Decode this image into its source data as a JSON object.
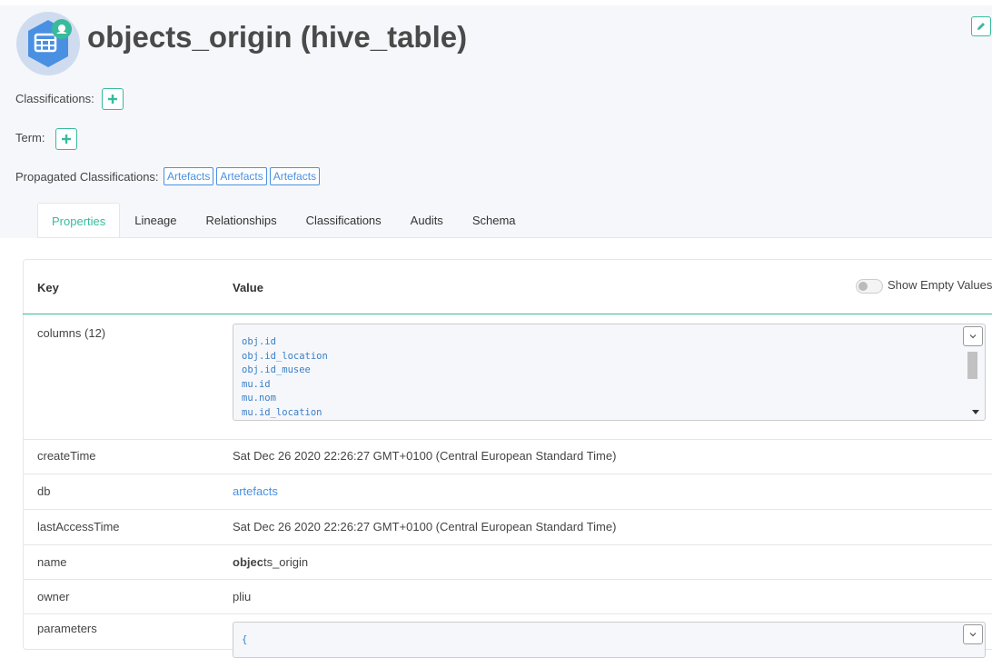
{
  "entity": {
    "title": "objects_origin (hive_table)"
  },
  "fields": {
    "classifications_label": "Classifications:",
    "term_label": "Term:",
    "propagated_label": "Propagated Classifications:",
    "propagated_tags": [
      "Artefacts",
      "Artefacts",
      "Artefacts"
    ]
  },
  "tabs": [
    {
      "label": "Properties",
      "active": true
    },
    {
      "label": "Lineage"
    },
    {
      "label": "Relationships"
    },
    {
      "label": "Classifications"
    },
    {
      "label": "Audits"
    },
    {
      "label": "Schema"
    }
  ],
  "table": {
    "key_header": "Key",
    "value_header": "Value",
    "show_empty_label": "Show Empty Values",
    "show_empty_on": false,
    "rows": {
      "columns": {
        "key": "columns (12)",
        "lines": [
          "obj.id",
          "obj.id_location",
          "obj.id_musee",
          "mu.id",
          "mu.nom",
          "mu.id_location"
        ]
      },
      "createTime": {
        "key": "createTime",
        "value": "Sat Dec 26 2020 22:26:27 GMT+0100 (Central European Standard Time)"
      },
      "db": {
        "key": "db",
        "value": "artefacts"
      },
      "lastAccessTime": {
        "key": "lastAccessTime",
        "value": "Sat Dec 26 2020 22:26:27 GMT+0100 (Central European Standard Time)"
      },
      "name": {
        "key": "name",
        "value_bold": "objec",
        "value_rest": "ts_origin"
      },
      "owner": {
        "key": "owner",
        "value": "pliu"
      },
      "parameters": {
        "key": "parameters",
        "value": "{"
      }
    }
  },
  "colors": {
    "accent": "#37bb9b",
    "link": "#4a90e2",
    "icon_blue": "#4a90e2"
  }
}
